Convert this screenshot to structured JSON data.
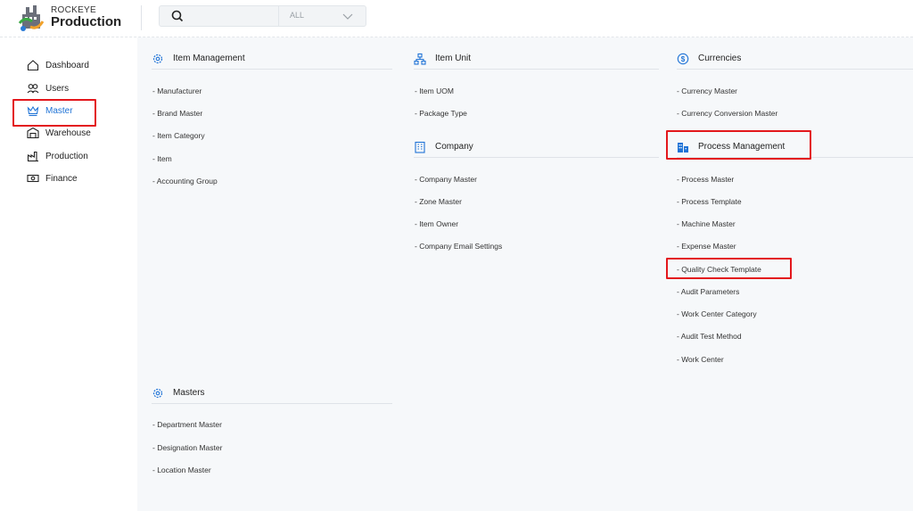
{
  "brand": {
    "small": "ROCKEYE",
    "big": "Production"
  },
  "search": {
    "value": "",
    "placeholder": "",
    "scope": "ALL"
  },
  "sidebar": {
    "items": [
      {
        "label": "Dashboard",
        "icon": "home-icon"
      },
      {
        "label": "Users",
        "icon": "users-icon"
      },
      {
        "label": "Master",
        "icon": "crown-icon",
        "active": true
      },
      {
        "label": "Warehouse",
        "icon": "warehouse-icon"
      },
      {
        "label": "Production",
        "icon": "factory-icon"
      },
      {
        "label": "Finance",
        "icon": "money-icon"
      }
    ]
  },
  "sections": {
    "item_management": {
      "title": "Item Management",
      "links": [
        "- Manufacturer",
        "- Brand Master",
        "- Item Category",
        "- Item",
        "- Accounting Group"
      ]
    },
    "item_unit": {
      "title": "Item Unit",
      "links": [
        "- Item UOM",
        "- Package Type"
      ]
    },
    "company": {
      "title": "Company",
      "links": [
        "- Company Master",
        "- Zone Master",
        "- Item Owner",
        "- Company Email Settings"
      ]
    },
    "currencies": {
      "title": "Currencies",
      "links": [
        "- Currency Master",
        "- Currency Conversion Master"
      ]
    },
    "process_management": {
      "title": "Process Management",
      "links": [
        "- Process Master",
        "- Process Template",
        "- Machine Master",
        "- Expense Master",
        "- Quality Check Template",
        "- Audit Parameters",
        "- Work Center Category",
        "- Audit Test Method",
        "- Work Center"
      ]
    },
    "masters": {
      "title": "Masters",
      "links": [
        "- Department Master",
        "- Designation Master",
        "- Location Master"
      ]
    }
  },
  "colors": {
    "accent": "#1f73d6",
    "highlight": "#e3171c",
    "background": "#f6f8fa"
  }
}
